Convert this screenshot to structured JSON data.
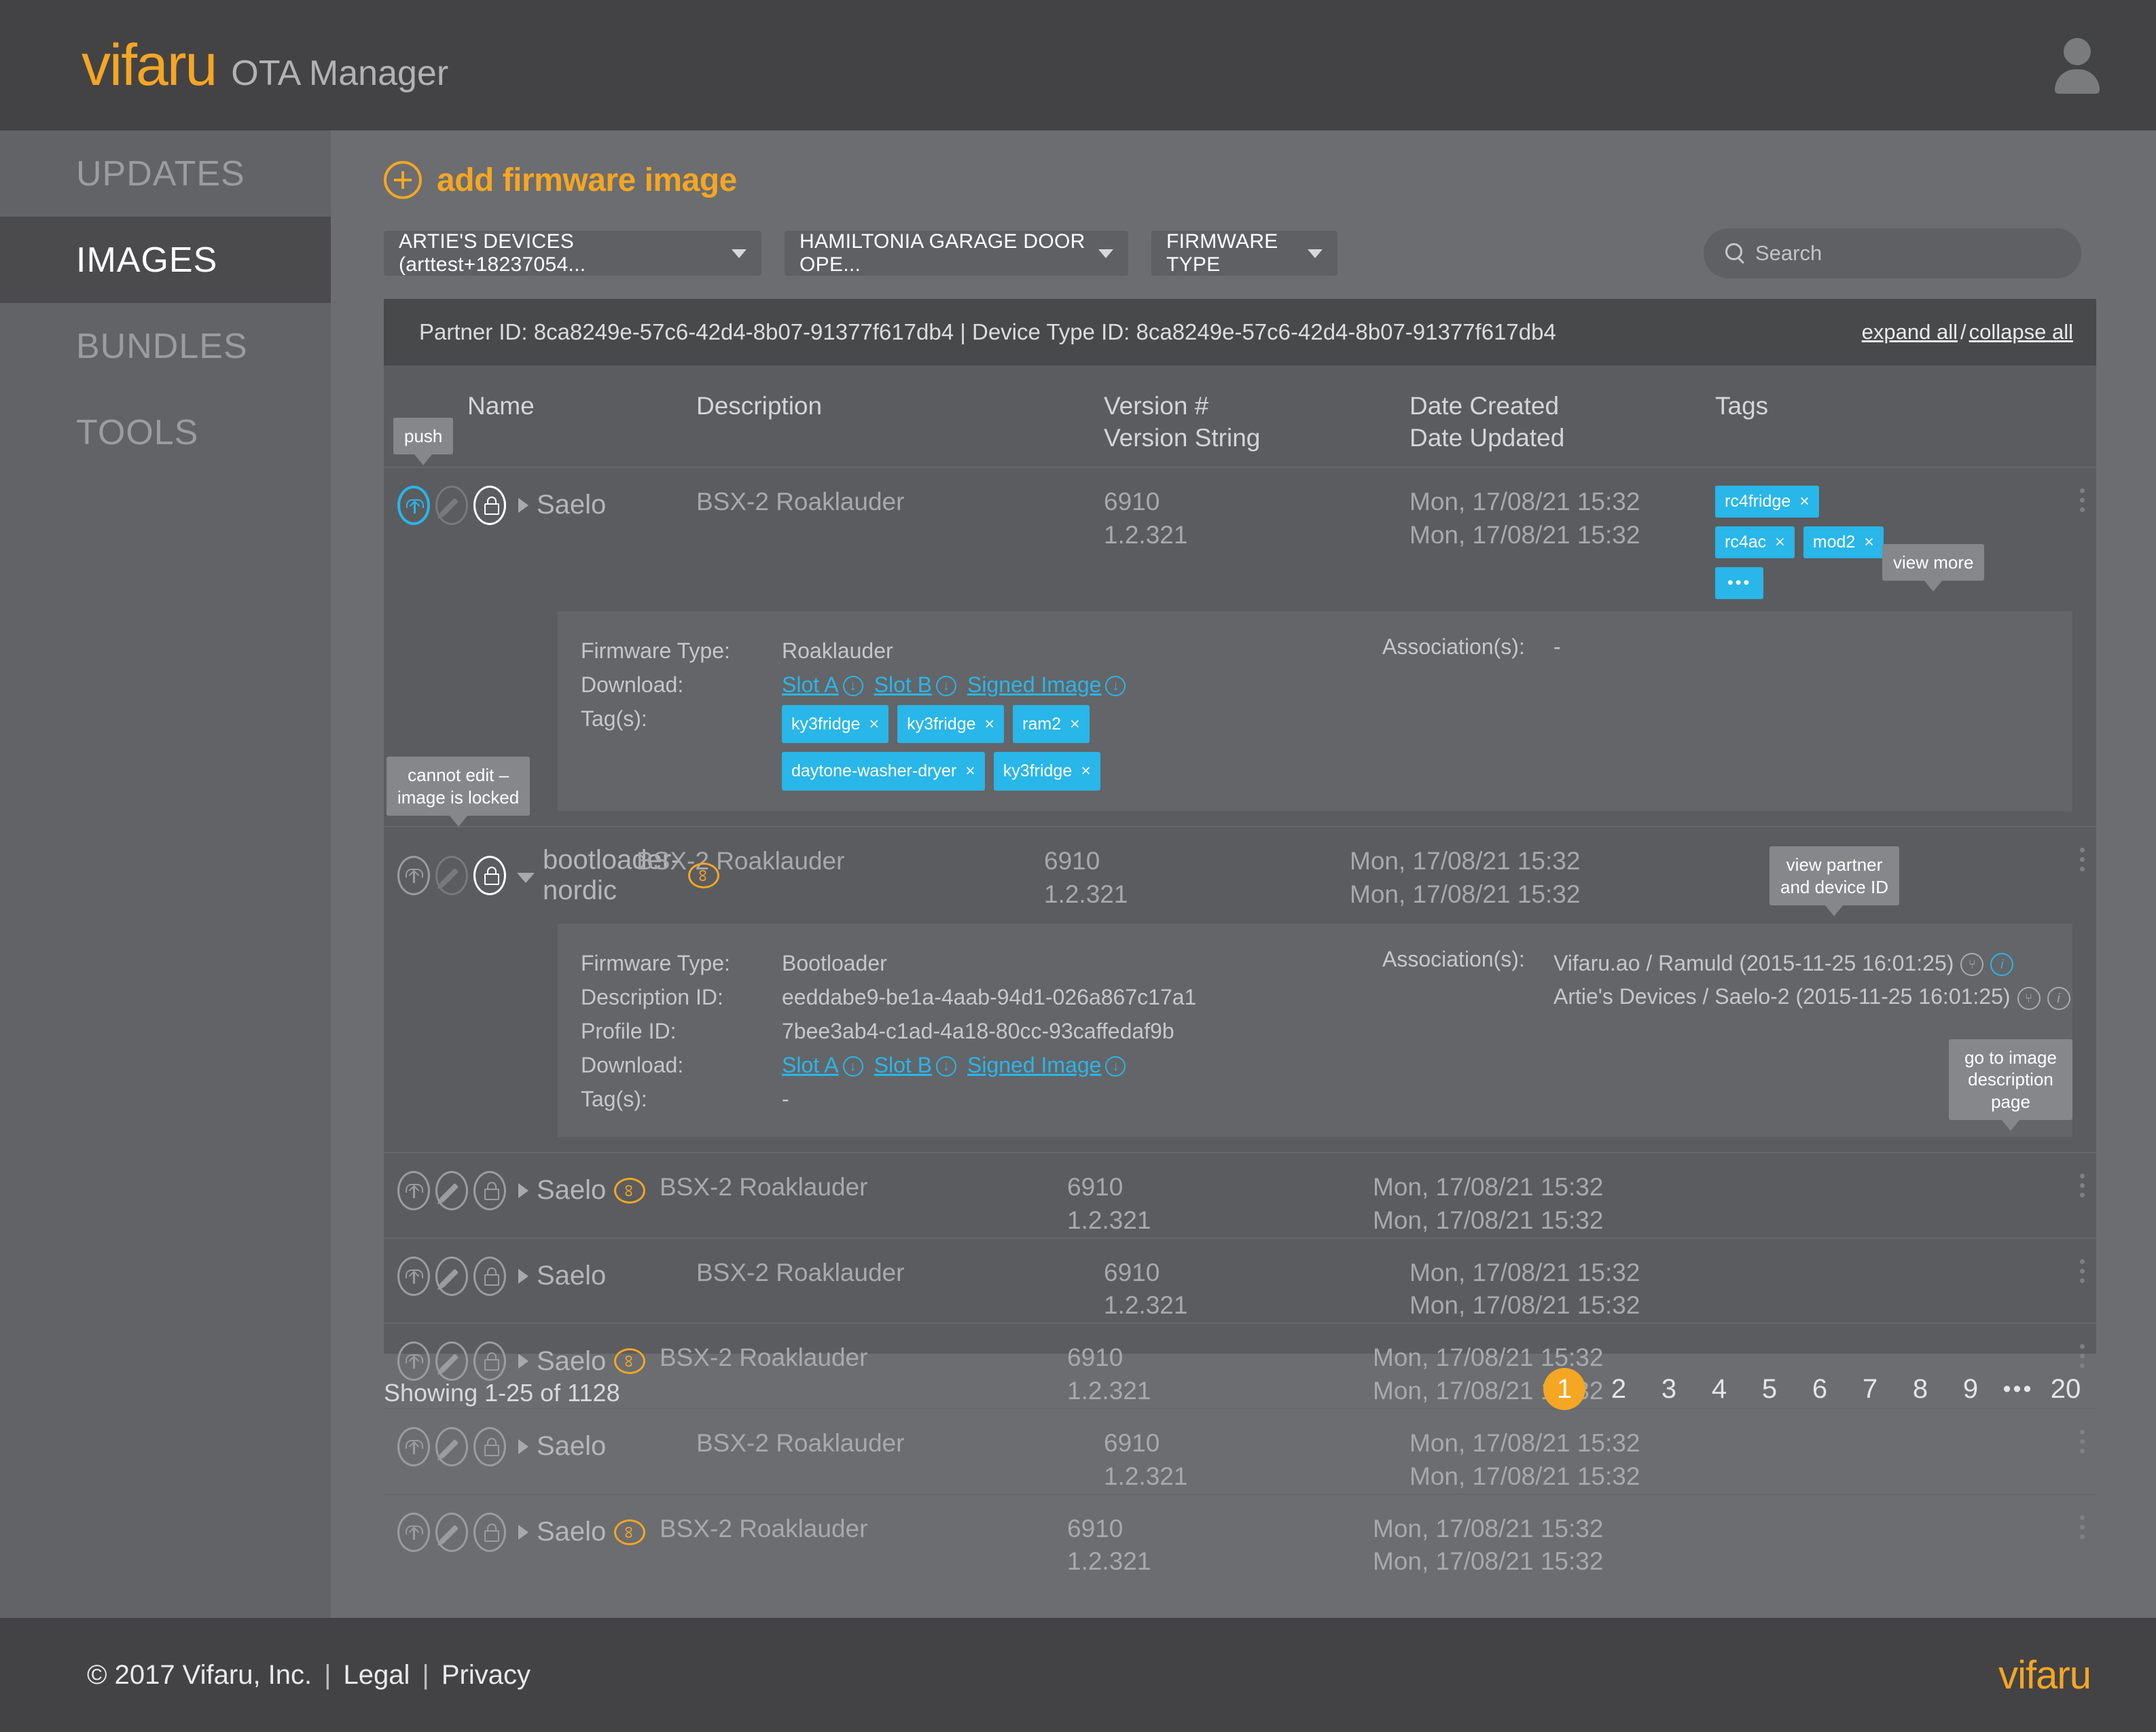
{
  "app": {
    "brand": "vifaru",
    "brand_sub": "OTA Manager",
    "avatar_icon": "user-avatar-icon"
  },
  "sidebar": {
    "items": [
      {
        "label": "UPDATES",
        "active": false
      },
      {
        "label": "IMAGES",
        "active": true
      },
      {
        "label": "BUNDLES",
        "active": false
      },
      {
        "label": "TOOLS",
        "active": false
      }
    ]
  },
  "toolbar": {
    "add_label": "add firmware image",
    "dropdowns": [
      {
        "label": "ARTIE'S DEVICES (arttest+18237054..."
      },
      {
        "label": "HAMILTONIA GARAGE DOOR OPE..."
      },
      {
        "label": "FIRMWARE TYPE"
      }
    ],
    "search": {
      "placeholder": "Search",
      "value": ""
    }
  },
  "panel": {
    "ids_text": "Partner ID: 8ca8249e-57c6-42d4-8b07-91377f617db4  |  Device Type ID: 8ca8249e-57c6-42d4-8b07-91377f617db4",
    "expand_all": "expand all",
    "separator": "/",
    "collapse_all": "collapse all",
    "columns": {
      "name": "Name",
      "description": "Description",
      "version_num": "Version #",
      "version_string": "Version String",
      "date_created": "Date Created",
      "date_updated": "Date Updated",
      "tags": "Tags"
    }
  },
  "rows": [
    {
      "name": "Saelo",
      "description": "BSX-2 Roaklauder",
      "version_num": "6910",
      "version_string": "1.2.321",
      "date_created": "Mon, 17/08/21 15:32",
      "date_updated": "Mon, 17/08/21 15:32",
      "has_link_badge": false,
      "tags": [
        {
          "label": "rc4fridge",
          "x": "×"
        },
        {
          "label": "rc4ac",
          "x": "×"
        },
        {
          "label": "mod2",
          "x": "×"
        },
        {
          "label": "•••",
          "more": true
        }
      ]
    },
    {
      "name": "bootloader-nordic",
      "description": "BSX-2 Roaklauder",
      "version_num": "6910",
      "version_string": "1.2.321",
      "date_created": "Mon, 17/08/21 15:32",
      "date_updated": "Mon, 17/08/21 15:32",
      "has_link_badge": true,
      "tags": []
    },
    {
      "name": "Saelo",
      "description": "BSX-2 Roaklauder",
      "version_num": "6910",
      "version_string": "1.2.321",
      "date_created": "Mon, 17/08/21 15:32",
      "date_updated": "Mon, 17/08/21 15:32",
      "has_link_badge": true,
      "tags": []
    },
    {
      "name": "Saelo",
      "description": "BSX-2 Roaklauder",
      "version_num": "6910",
      "version_string": "1.2.321",
      "date_created": "Mon, 17/08/21 15:32",
      "date_updated": "Mon, 17/08/21 15:32",
      "has_link_badge": false,
      "tags": []
    },
    {
      "name": "Saelo",
      "description": "BSX-2 Roaklauder",
      "version_num": "6910",
      "version_string": "1.2.321",
      "date_created": "Mon, 17/08/21 15:32",
      "date_updated": "Mon, 17/08/21 15:32",
      "has_link_badge": true,
      "tags": []
    },
    {
      "name": "Saelo",
      "description": "BSX-2 Roaklauder",
      "version_num": "6910",
      "version_string": "1.2.321",
      "date_created": "Mon, 17/08/21 15:32",
      "date_updated": "Mon, 17/08/21 15:32",
      "has_link_badge": false,
      "tags": []
    },
    {
      "name": "Saelo",
      "description": "BSX-2 Roaklauder",
      "version_num": "6910",
      "version_string": "1.2.321",
      "date_created": "Mon, 17/08/21 15:32",
      "date_updated": "Mon, 17/08/21 15:32",
      "has_link_badge": true,
      "tags": []
    }
  ],
  "detail_1": {
    "labels": {
      "firmware_type": "Firmware Type:",
      "download": "Download:",
      "tags": "Tag(s):"
    },
    "firmware_type": "Roaklauder",
    "download": {
      "slot_a": "Slot A",
      "slot_b": "Slot B",
      "signed_image": "Signed Image",
      "download_icon": "↓"
    },
    "tags": [
      {
        "label": "ky3fridge",
        "x": "×"
      },
      {
        "label": "ky3fridge",
        "x": "×"
      },
      {
        "label": "ram2",
        "x": "×"
      },
      {
        "label": "daytone-washer-dryer",
        "x": "×"
      },
      {
        "label": "ky3fridge",
        "x": "×"
      }
    ],
    "associations_label": "Association(s):",
    "associations_value": "-"
  },
  "detail_2": {
    "labels": {
      "firmware_type": "Firmware Type:",
      "description_id": "Description ID:",
      "profile_id": "Profile ID:",
      "download": "Download:",
      "tags": "Tag(s):"
    },
    "firmware_type": "Bootloader",
    "description_id": "eeddabe9-be1a-4aab-94d1-026a867c17a1",
    "profile_id": "7bee3ab4-c1ad-4a18-80cc-93caffedaf9b",
    "download": {
      "slot_a": "Slot A",
      "slot_b": "Slot B",
      "signed_image": "Signed Image",
      "download_icon": "↓"
    },
    "tags_value": "-",
    "associations_label": "Association(s):",
    "associations": [
      {
        "text": "Vifaru.ao / Ramuld (2015-11-25 16:01:25)",
        "device_icon": "⑂",
        "info_icon": "i"
      },
      {
        "text": "Artie's Devices / Saelo-2 (2015-11-25 16:01:25)",
        "device_icon": "⑂",
        "info_icon": "i"
      }
    ]
  },
  "tooltips": {
    "push": "push",
    "cannot_edit": "cannot edit –\nimage is locked",
    "view_more": "view more",
    "view_partner": "view partner\nand device ID",
    "go_to_image": "go to image\ndescription page"
  },
  "pagination": {
    "showing": "Showing 1-25 of 1128",
    "pages": [
      "1",
      "2",
      "3",
      "4",
      "5",
      "6",
      "7",
      "8",
      "9",
      "•••",
      "20"
    ],
    "current": "1"
  },
  "footer": {
    "copyright": "© 2017 Vifaru, Inc.",
    "sep": "|",
    "legal": "Legal",
    "privacy": "Privacy",
    "logo": "vifaru"
  },
  "colors": {
    "accent": "#f5a623",
    "tag": "#29b6e8",
    "link": "#29b6e8",
    "panel_bg": "#5a5c5f",
    "page_bg": "#6b6d70",
    "chrome": "#434345"
  }
}
